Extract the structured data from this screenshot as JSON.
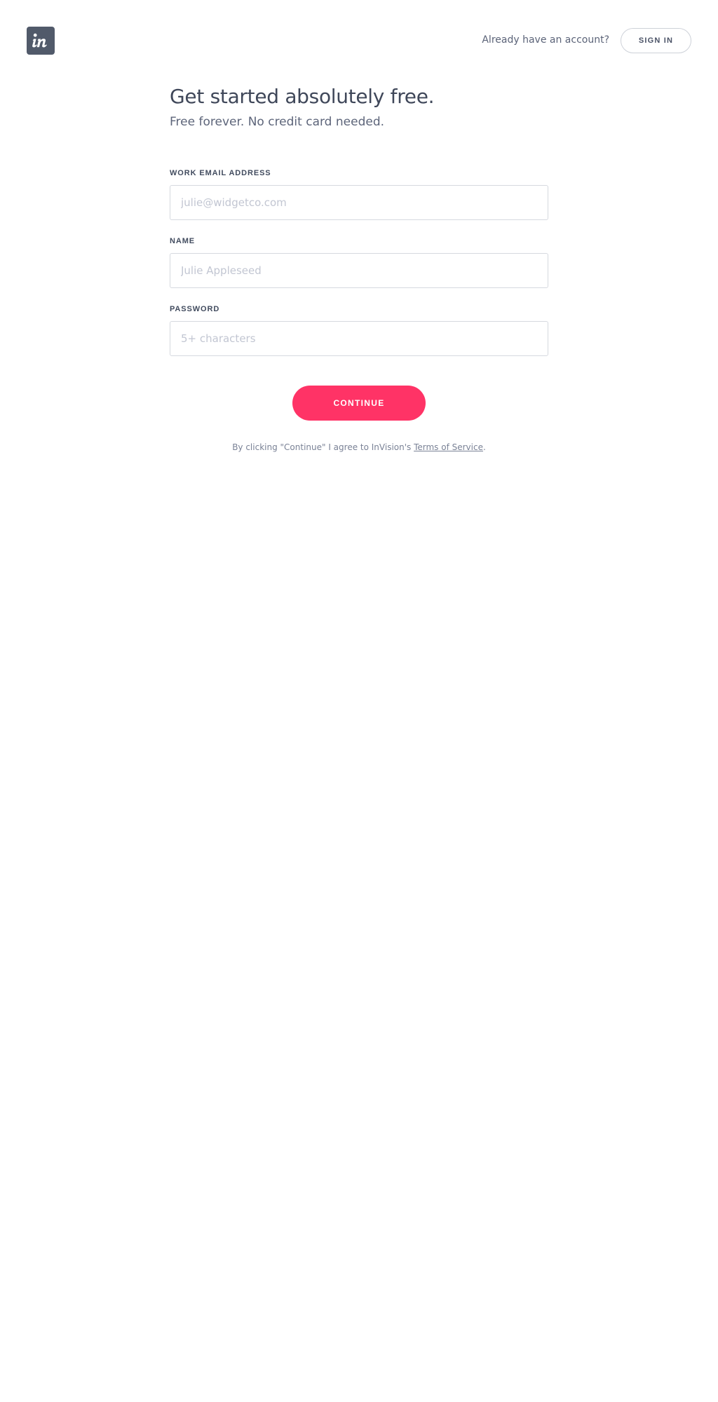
{
  "brand": {
    "logo_text": "in",
    "accent_color": "#ff3366",
    "logo_bg_color": "#515a6a"
  },
  "header": {
    "account_prompt": "Already have an account?",
    "signin_label": "SIGN IN"
  },
  "main": {
    "headline": "Get started absolutely free.",
    "subhead": "Free forever. No credit card needed."
  },
  "form": {
    "email": {
      "label": "WORK EMAIL ADDRESS",
      "placeholder": "julie@widgetco.com",
      "value": ""
    },
    "name": {
      "label": "NAME",
      "placeholder": "Julie Appleseed",
      "value": ""
    },
    "password": {
      "label": "PASSWORD",
      "placeholder": "5+ characters",
      "value": ""
    },
    "submit_label": "CONTINUE"
  },
  "terms": {
    "prefix": "By clicking \"Continue\" I agree to InVision's ",
    "link_text": "Terms of Service",
    "suffix": "."
  }
}
